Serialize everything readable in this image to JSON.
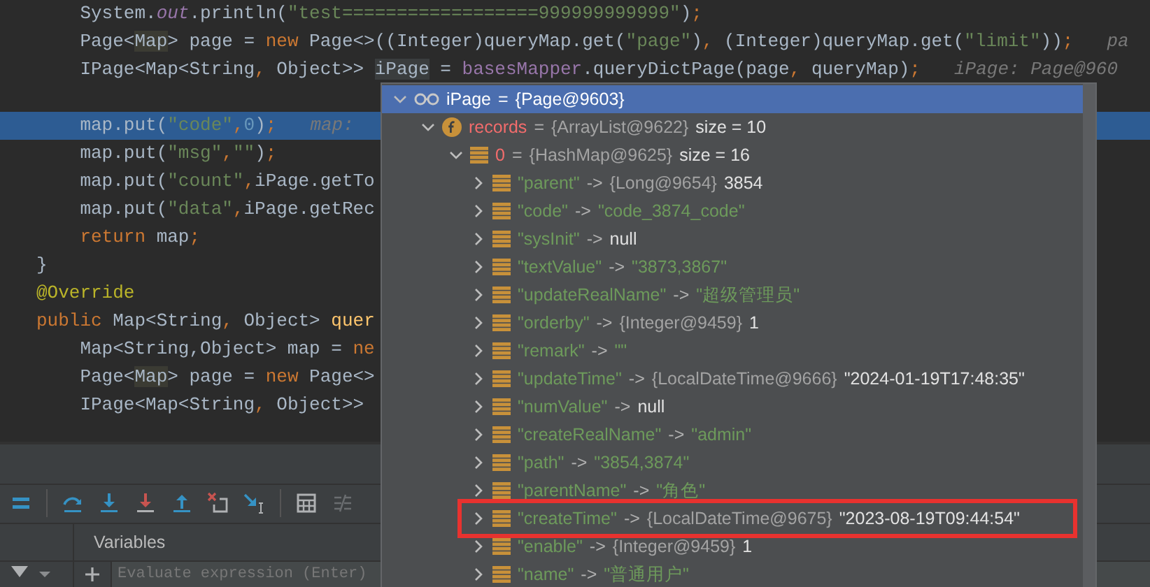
{
  "editor": {
    "lines": [
      {
        "current": false,
        "code": [
          {
            "text": "    System.",
            "kind": "plain"
          },
          {
            "text": "out",
            "kind": "static"
          },
          {
            "text": ".println(",
            "kind": "plain"
          },
          {
            "text": "\"test==================999999999999\"",
            "kind": "string"
          },
          {
            "text": ")",
            "kind": "plain"
          },
          {
            "text": ";",
            "kind": "keyword"
          }
        ]
      },
      {
        "current": false,
        "code": [
          {
            "text": "    Page<",
            "kind": "plain"
          },
          {
            "text": "Map",
            "kind": "match"
          },
          {
            "text": "> page = ",
            "kind": "plain"
          },
          {
            "text": "new",
            "kind": "keyword"
          },
          {
            "text": " Page<>((Integer)queryMap.get(",
            "kind": "plain"
          },
          {
            "text": "\"page\"",
            "kind": "string"
          },
          {
            "text": ")",
            "kind": "plain"
          },
          {
            "text": ",",
            "kind": "keyword"
          },
          {
            "text": " (Integer)queryMap.get(",
            "kind": "plain"
          },
          {
            "text": "\"limit\"",
            "kind": "string"
          },
          {
            "text": "))",
            "kind": "plain"
          },
          {
            "text": ";",
            "kind": "keyword"
          }
        ],
        "hint": "pa"
      },
      {
        "current": false,
        "code": [
          {
            "text": "    IPage<Map<String",
            "kind": "plain"
          },
          {
            "text": ",",
            "kind": "keyword"
          },
          {
            "text": " Object>> ",
            "kind": "plain"
          },
          {
            "text": "iPage",
            "kind": "selected"
          },
          {
            "text": " = ",
            "kind": "plain"
          },
          {
            "text": "basesMapper",
            "kind": "field"
          },
          {
            "text": ".queryDictPage(page",
            "kind": "plain"
          },
          {
            "text": ",",
            "kind": "keyword"
          },
          {
            "text": " queryMap)",
            "kind": "plain"
          },
          {
            "text": ";",
            "kind": "keyword"
          }
        ],
        "hint": "iPage: Page@960"
      },
      {
        "current": false
      },
      {
        "current": true,
        "code": [
          {
            "text": "    map.put(",
            "kind": "plain"
          },
          {
            "text": "\"code\"",
            "kind": "string"
          },
          {
            "text": ",",
            "kind": "keyword"
          },
          {
            "text": "0",
            "kind": "number"
          },
          {
            "text": ")",
            "kind": "plain"
          },
          {
            "text": ";",
            "kind": "keyword"
          }
        ],
        "hint": "map:"
      },
      {
        "current": false,
        "code": [
          {
            "text": "    map.put(",
            "kind": "plain"
          },
          {
            "text": "\"msg\"",
            "kind": "string"
          },
          {
            "text": ",",
            "kind": "keyword"
          },
          {
            "text": "\"\"",
            "kind": "string"
          },
          {
            "text": ")",
            "kind": "plain"
          },
          {
            "text": ";",
            "kind": "keyword"
          }
        ]
      },
      {
        "current": false,
        "code": [
          {
            "text": "    map.put(",
            "kind": "plain"
          },
          {
            "text": "\"count\"",
            "kind": "string"
          },
          {
            "text": ",",
            "kind": "keyword"
          },
          {
            "text": "iPage.getTo",
            "kind": "plain"
          }
        ]
      },
      {
        "current": false,
        "code": [
          {
            "text": "    map.put(",
            "kind": "plain"
          },
          {
            "text": "\"data\"",
            "kind": "string"
          },
          {
            "text": ",",
            "kind": "keyword"
          },
          {
            "text": "iPage.getRec",
            "kind": "plain"
          }
        ]
      },
      {
        "current": false,
        "code": [
          {
            "text": "    return",
            "kind": "keyword"
          },
          {
            "text": " map",
            "kind": "plain"
          },
          {
            "text": ";",
            "kind": "keyword"
          }
        ]
      },
      {
        "current": false,
        "code": [
          {
            "text": "}",
            "kind": "plain"
          }
        ]
      },
      {
        "current": false,
        "code": [
          {
            "text": "@Override",
            "kind": "annotation"
          }
        ]
      },
      {
        "current": false,
        "code": [
          {
            "text": "public",
            "kind": "keyword"
          },
          {
            "text": " Map<String",
            "kind": "plain"
          },
          {
            "text": ",",
            "kind": "keyword"
          },
          {
            "text": " Object> ",
            "kind": "plain"
          },
          {
            "text": "quer",
            "kind": "method"
          }
        ]
      },
      {
        "current": false,
        "code": [
          {
            "text": "    Map<String,Object> map = ",
            "kind": "plain"
          },
          {
            "text": "ne",
            "kind": "keyword"
          }
        ]
      },
      {
        "current": false,
        "code": [
          {
            "text": "    Page<",
            "kind": "plain"
          },
          {
            "text": "Map",
            "kind": "match"
          },
          {
            "text": "> page = ",
            "kind": "plain"
          },
          {
            "text": "new",
            "kind": "keyword"
          },
          {
            "text": " Page<>",
            "kind": "plain"
          }
        ]
      },
      {
        "current": false,
        "code": [
          {
            "text": "    IPage<Map<String",
            "kind": "plain"
          },
          {
            "text": ",",
            "kind": "keyword"
          },
          {
            "text": " Object>>",
            "kind": "plain"
          }
        ]
      }
    ]
  },
  "debug_popup": {
    "root": {
      "kind": "watch",
      "name": "iPage",
      "sep": "=",
      "type": "{Page@9603}",
      "expanded": true,
      "selected": true,
      "highlighted": false,
      "children": [
        {
          "kind": "field",
          "name": "records",
          "sep": "=",
          "type": "{ArrayList@9622}",
          "value": "size = 10",
          "is_string": false,
          "expanded": true,
          "selected": false,
          "highlighted": false,
          "children": [
            {
              "kind": "index",
              "name": "0",
              "sep": "=",
              "type": "{HashMap@9625}",
              "value": "size = 16",
              "is_string": false,
              "expanded": true,
              "selected": false,
              "highlighted": false,
              "children": [
                {
                  "kind": "entry",
                  "name": "\"parent\"",
                  "sep": "->",
                  "type": "{Long@9654}",
                  "value": "3854",
                  "is_string": false,
                  "expanded": false,
                  "selected": false,
                  "highlighted": false
                },
                {
                  "kind": "entry",
                  "name": "\"code\"",
                  "sep": "->",
                  "value": "\"code_3874_code\"",
                  "is_string": true,
                  "expanded": false,
                  "selected": false,
                  "highlighted": false
                },
                {
                  "kind": "entry",
                  "name": "\"sysInit\"",
                  "sep": "->",
                  "value": "null",
                  "is_string": false,
                  "expanded": false,
                  "selected": false,
                  "highlighted": false
                },
                {
                  "kind": "entry",
                  "name": "\"textValue\"",
                  "sep": "->",
                  "value": "\"3873,3867\"",
                  "is_string": true,
                  "expanded": false,
                  "selected": false,
                  "highlighted": false
                },
                {
                  "kind": "entry",
                  "name": "\"updateRealName\"",
                  "sep": "->",
                  "value": "\"超级管理员\"",
                  "is_string": true,
                  "expanded": false,
                  "selected": false,
                  "highlighted": false
                },
                {
                  "kind": "entry",
                  "name": "\"orderby\"",
                  "sep": "->",
                  "type": "{Integer@9459}",
                  "value": "1",
                  "is_string": false,
                  "expanded": false,
                  "selected": false,
                  "highlighted": false
                },
                {
                  "kind": "entry",
                  "name": "\"remark\"",
                  "sep": "->",
                  "value": "\"\"",
                  "is_string": true,
                  "expanded": false,
                  "selected": false,
                  "highlighted": false
                },
                {
                  "kind": "entry",
                  "name": "\"updateTime\"",
                  "sep": "->",
                  "type": "{LocalDateTime@9666}",
                  "value": "\"2024-01-19T17:48:35\"",
                  "is_string": false,
                  "expanded": false,
                  "selected": false,
                  "highlighted": false
                },
                {
                  "kind": "entry",
                  "name": "\"numValue\"",
                  "sep": "->",
                  "value": "null",
                  "is_string": false,
                  "expanded": false,
                  "selected": false,
                  "highlighted": false
                },
                {
                  "kind": "entry",
                  "name": "\"createRealName\"",
                  "sep": "->",
                  "value": "\"admin\"",
                  "is_string": true,
                  "expanded": false,
                  "selected": false,
                  "highlighted": false
                },
                {
                  "kind": "entry",
                  "name": "\"path\"",
                  "sep": "->",
                  "value": "\"3854,3874\"",
                  "is_string": true,
                  "expanded": false,
                  "selected": false,
                  "highlighted": false
                },
                {
                  "kind": "entry",
                  "name": "\"parentName\"",
                  "sep": "->",
                  "value": "\"角色\"",
                  "is_string": true,
                  "expanded": false,
                  "selected": false,
                  "highlighted": false
                },
                {
                  "kind": "entry",
                  "name": "\"createTime\"",
                  "sep": "->",
                  "type": "{LocalDateTime@9675}",
                  "value": "\"2023-08-19T09:44:54\"",
                  "is_string": false,
                  "expanded": false,
                  "selected": false,
                  "highlighted": true
                },
                {
                  "kind": "entry",
                  "name": "\"enable\"",
                  "sep": "->",
                  "type": "{Integer@9459}",
                  "value": "1",
                  "is_string": false,
                  "expanded": false,
                  "selected": false,
                  "highlighted": false
                },
                {
                  "kind": "entry",
                  "name": "\"name\"",
                  "sep": "->",
                  "value": "\"普通用户\"",
                  "is_string": true,
                  "expanded": false,
                  "selected": false,
                  "highlighted": false
                }
              ]
            }
          ]
        }
      ]
    }
  },
  "debugger": {
    "toolbar": [
      {
        "kind": "layout",
        "disabled": false
      },
      {
        "kind": "step-over",
        "disabled": false
      },
      {
        "kind": "step-into",
        "disabled": false
      },
      {
        "kind": "force-step-into",
        "disabled": false
      },
      {
        "kind": "step-out",
        "disabled": false
      },
      {
        "kind": "drop-frame",
        "disabled": false
      },
      {
        "kind": "run-to-cursor",
        "disabled": false
      },
      {
        "kind": "evaluate",
        "disabled": false
      },
      {
        "kind": "trace",
        "disabled": true
      }
    ],
    "variables_tab": "Variables",
    "evaluate": {
      "placeholder": "Evaluate expression (Enter)"
    }
  }
}
